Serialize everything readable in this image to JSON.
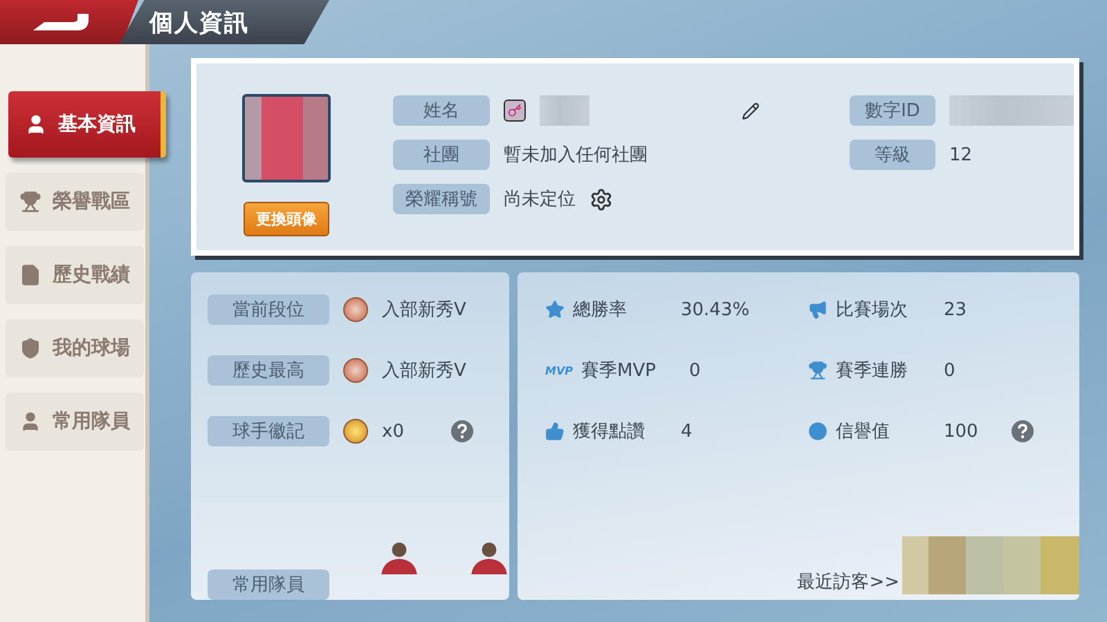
{
  "header": {
    "title": "個人資訊"
  },
  "sidebar": {
    "items": [
      {
        "label": "基本資訊",
        "selected": true
      },
      {
        "label": "榮譽戰區",
        "selected": false
      },
      {
        "label": "歷史戰績",
        "selected": false
      },
      {
        "label": "我的球場",
        "selected": false
      },
      {
        "label": "常用隊員",
        "selected": false
      }
    ]
  },
  "profile": {
    "change_avatar_button": "更換頭像",
    "name": {
      "label": "姓名"
    },
    "club": {
      "label": "社團",
      "value": "暫未加入任何社團"
    },
    "honor_title": {
      "label": "榮耀稱號",
      "value": "尚未定位"
    },
    "numeric_id": {
      "label": "數字ID"
    },
    "level": {
      "label": "等級",
      "value": "12"
    }
  },
  "rank_rows": [
    {
      "label": "當前段位",
      "value": "入部新秀Ⅴ",
      "kind": "rank",
      "help": false
    },
    {
      "label": "歷史最高",
      "value": "入部新秀Ⅴ",
      "kind": "rank",
      "help": false
    },
    {
      "label": "球手徽記",
      "value": "x0",
      "kind": "emblem",
      "help": true
    }
  ],
  "stats": [
    {
      "label": "總勝率",
      "value": "30.43%",
      "help": false
    },
    {
      "label": "比賽場次",
      "value": "23",
      "help": false
    },
    {
      "label": "賽季MVP",
      "value": "0",
      "help": false,
      "icon_text": "MVP"
    },
    {
      "label": "賽季連勝",
      "value": "0",
      "help": false
    },
    {
      "label": "獲得點讚",
      "value": "4",
      "help": false
    },
    {
      "label": "信譽值",
      "value": "100",
      "help": true
    }
  ],
  "favorite_players": {
    "label": "常用隊員"
  },
  "recent_visitors": {
    "label": "最近訪客>>"
  }
}
